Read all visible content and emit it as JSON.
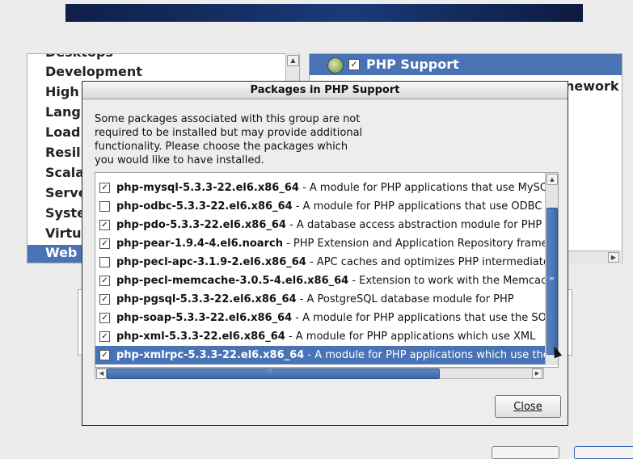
{
  "background": {
    "groups": [
      "Desktops",
      "Development",
      "High",
      "Lang",
      "Load",
      "Resili",
      "Scala",
      "Serve",
      "Syste",
      "Virtu",
      "Web"
    ],
    "selected_group": "Web",
    "right_header": "PHP Support",
    "right_peek": "nework"
  },
  "dialog": {
    "title": "Packages in PHP Support",
    "description": "Some packages associated with this group are not required to be installed but may provide additional functionality.  Please choose the packages which you would like to have installed.",
    "packages": [
      {
        "name": "php-mysql-5.3.3-22.el6.x86_64",
        "desc": " - A module for PHP applications that use MySQL databases",
        "checked": true,
        "selected": false
      },
      {
        "name": "php-odbc-5.3.3-22.el6.x86_64",
        "desc": " - A module for PHP applications that use ODBC databases",
        "checked": false,
        "selected": false
      },
      {
        "name": "php-pdo-5.3.3-22.el6.x86_64",
        "desc": " - A database access abstraction module for PHP applications",
        "checked": true,
        "selected": false
      },
      {
        "name": "php-pear-1.9.4-4.el6.noarch",
        "desc": " - PHP Extension and Application Repository framework",
        "checked": true,
        "selected": false
      },
      {
        "name": "php-pecl-apc-3.1.9-2.el6.x86_64",
        "desc": " - APC caches and optimizes PHP intermediate code",
        "checked": false,
        "selected": false
      },
      {
        "name": "php-pecl-memcache-3.0.5-4.el6.x86_64",
        "desc": " - Extension to work with the Memcached caching daemon",
        "checked": true,
        "selected": false
      },
      {
        "name": "php-pgsql-5.3.3-22.el6.x86_64",
        "desc": " - A PostgreSQL database module for PHP",
        "checked": true,
        "selected": false
      },
      {
        "name": "php-soap-5.3.3-22.el6.x86_64",
        "desc": " - A module for PHP applications that use the SOAP protocol",
        "checked": true,
        "selected": false
      },
      {
        "name": "php-xml-5.3.3-22.el6.x86_64",
        "desc": " - A module for PHP applications which use XML",
        "checked": true,
        "selected": false
      },
      {
        "name": "php-xmlrpc-5.3.3-22.el6.x86_64",
        "desc": " - A module for PHP applications which use the XML-RPC protocol",
        "checked": true,
        "selected": true
      }
    ],
    "close_label": "Close"
  },
  "colors": {
    "selection": "#4a73b5",
    "banner": "#1a3a78"
  }
}
